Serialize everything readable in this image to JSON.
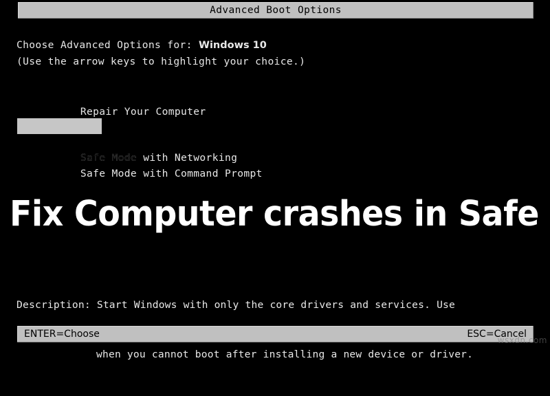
{
  "screen": {
    "background_color": "#000000",
    "foreground_color": "#e8e8e8",
    "chrome_color": "#c0c0c0"
  },
  "title_bar": {
    "title": "Advanced Boot Options"
  },
  "prompt": {
    "choose_label": "Choose Advanced Options for: ",
    "os_name": "Windows 10",
    "hint": "(Use the arrow keys to highlight your choice.)"
  },
  "menu": {
    "items": [
      {
        "label": "Repair Your Computer",
        "selected": false
      },
      {
        "label": "Safe Mode",
        "selected": true
      },
      {
        "label": "Safe Mode with Networking",
        "selected": false
      },
      {
        "label": "Safe Mode with Command Prompt",
        "selected": false
      }
    ],
    "highlight_color": "#c6c6c6"
  },
  "overlay": {
    "headline": "Fix Computer crashes in Safe Mode"
  },
  "description": {
    "label": "Description: ",
    "line1": "Start Windows with only the core drivers and services. Use",
    "line2": "when you cannot boot after installing a new device or driver."
  },
  "status_bar": {
    "left": "ENTER=Choose",
    "right": "ESC=Cancel"
  },
  "watermark": {
    "text": "wsxdn.com"
  }
}
